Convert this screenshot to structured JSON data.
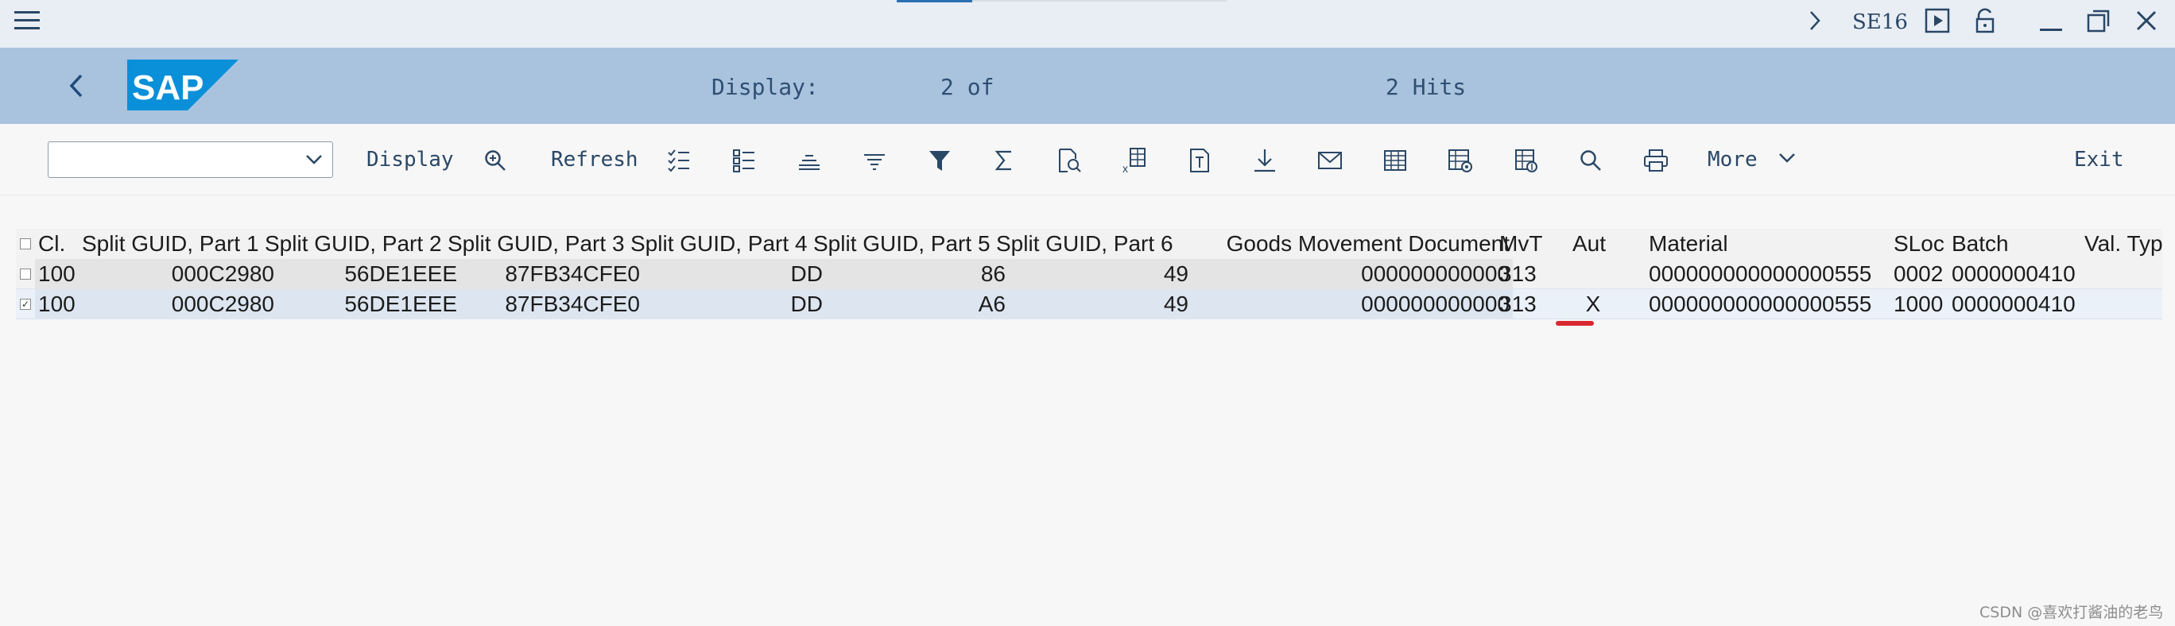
{
  "system_bar": {
    "menu_icon": "hamburger-menu-icon",
    "nav_icon": "chevron-right-icon",
    "transaction_code": "SE16",
    "icons": [
      "play-icon",
      "unlock-icon",
      "minimize-icon",
      "restore-icon",
      "close-icon"
    ]
  },
  "title_bar": {
    "back_icon": "chevron-left-icon",
    "logo": "SAP",
    "display_label": "Display:",
    "display_count": "2 of",
    "hits_label": "2 Hits"
  },
  "toolbar": {
    "layout_select_value": "",
    "display_label": "Display",
    "refresh_label": "Refresh",
    "more_label": "More",
    "exit_label": "Exit",
    "icons": [
      "display-zoom-icon",
      "check-list-icon",
      "detail-list-icon",
      "align-center-icon",
      "sort-lines-icon",
      "filter-icon",
      "sum-icon",
      "print-preview-icon",
      "excel-export-icon",
      "text-document-icon",
      "download-icon",
      "email-icon",
      "table-icon",
      "table-settings-icon",
      "table-config-icon",
      "search-icon",
      "printer-icon"
    ]
  },
  "table": {
    "columns": [
      "Cl.",
      "Split GUID, Part 1",
      "Split GUID, Part 2",
      "Split GUID, Part 3",
      "Split GUID, Part 4",
      "Split GUID, Part 5",
      "Split GUID, Part 6",
      "Goods Movement Document",
      "MvT",
      "Aut",
      "Material",
      "SLoc",
      "Batch",
      "Val. Typ"
    ],
    "rows": [
      {
        "selected": false,
        "cells": [
          "100",
          "000C2980",
          "56DE1EEE",
          "87FB34CFE0",
          "DD",
          "86",
          "49",
          "000000000000",
          "313",
          "",
          "000000000000000555",
          "0002",
          "0000000410",
          ""
        ]
      },
      {
        "selected": true,
        "cells": [
          "100",
          "000C2980",
          "56DE1EEE",
          "87FB34CFE0",
          "DD",
          "A6",
          "49",
          "000000000000",
          "313",
          "X",
          "000000000000000555",
          "1000",
          "0000000410",
          ""
        ]
      }
    ],
    "highlight_color": "#d9272e"
  },
  "watermark": "CSDN @喜欢打酱油的老鸟"
}
